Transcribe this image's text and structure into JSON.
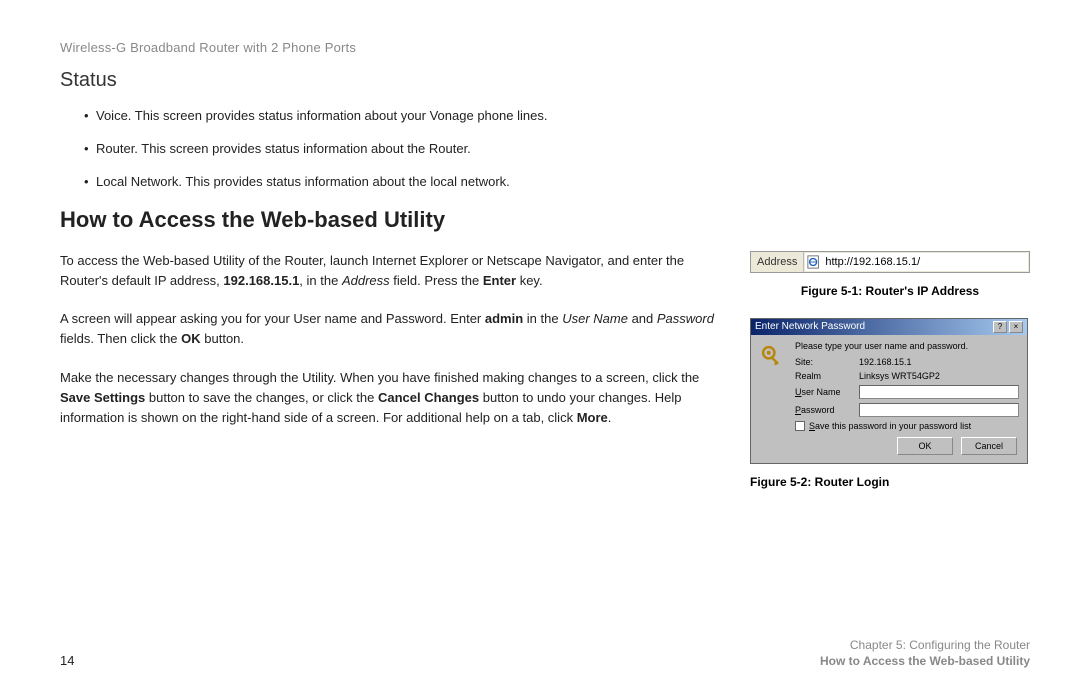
{
  "product_header": "Wireless-G Broadband Router with 2 Phone Ports",
  "status": {
    "heading": "Status",
    "bullets": [
      "Voice. This screen provides status information about your Vonage phone lines.",
      "Router. This screen provides status information about the Router.",
      "Local Network. This provides status information about the local network."
    ]
  },
  "main_heading": "How to Access the Web-based Utility",
  "para1": {
    "pre": "To access the Web-based Utility of the Router, launch Internet Explorer or Netscape Navigator, and enter the Router's default IP address, ",
    "ip": "192.168.15.1",
    "mid": ", in the ",
    "field_word": "Address",
    "post1": " field. Press the ",
    "enter_word": "Enter",
    "post2": " key."
  },
  "para2": {
    "pre": "A screen will appear asking you for your User name and Password. Enter ",
    "admin": "admin",
    "mid1": " in the ",
    "user_name": "User Name",
    "mid2": " and ",
    "password": "Password",
    "post1": " fields. Then click the ",
    "ok": "OK",
    "post2": " button."
  },
  "para3": {
    "pre": "Make the necessary changes through the Utility. When you have finished making changes to a screen, click the ",
    "save": "Save Settings",
    "mid1": " button to save the changes, or click the ",
    "cancel": "Cancel Changes",
    "mid2": " button to undo your changes. Help information is shown on the right-hand side of a screen. For additional help on a tab, click ",
    "more": "More",
    "post": "."
  },
  "fig1": {
    "addr_label": "Address",
    "url": "http://192.168.15.1/",
    "caption": "Figure 5-1: Router's IP Address"
  },
  "fig2": {
    "title": "Enter Network Password",
    "message": "Please type your user name and password.",
    "site_label": "Site:",
    "site_value": "192.168.15.1",
    "realm_label": "Realm",
    "realm_value": "Linksys WRT54GP2",
    "user_name_label_pre": "U",
    "user_name_label_post": "ser Name",
    "password_label_pre": "P",
    "password_label_post": "assword",
    "save_check_pre": "S",
    "save_check_post": "ave this password in your password list",
    "ok_btn": "OK",
    "cancel_btn": "Cancel",
    "caption": "Figure 5-2: Router Login"
  },
  "footer": {
    "page_num": "14",
    "chapter": "Chapter 5: Configuring the Router",
    "section": "How to Access the Web-based Utility"
  }
}
